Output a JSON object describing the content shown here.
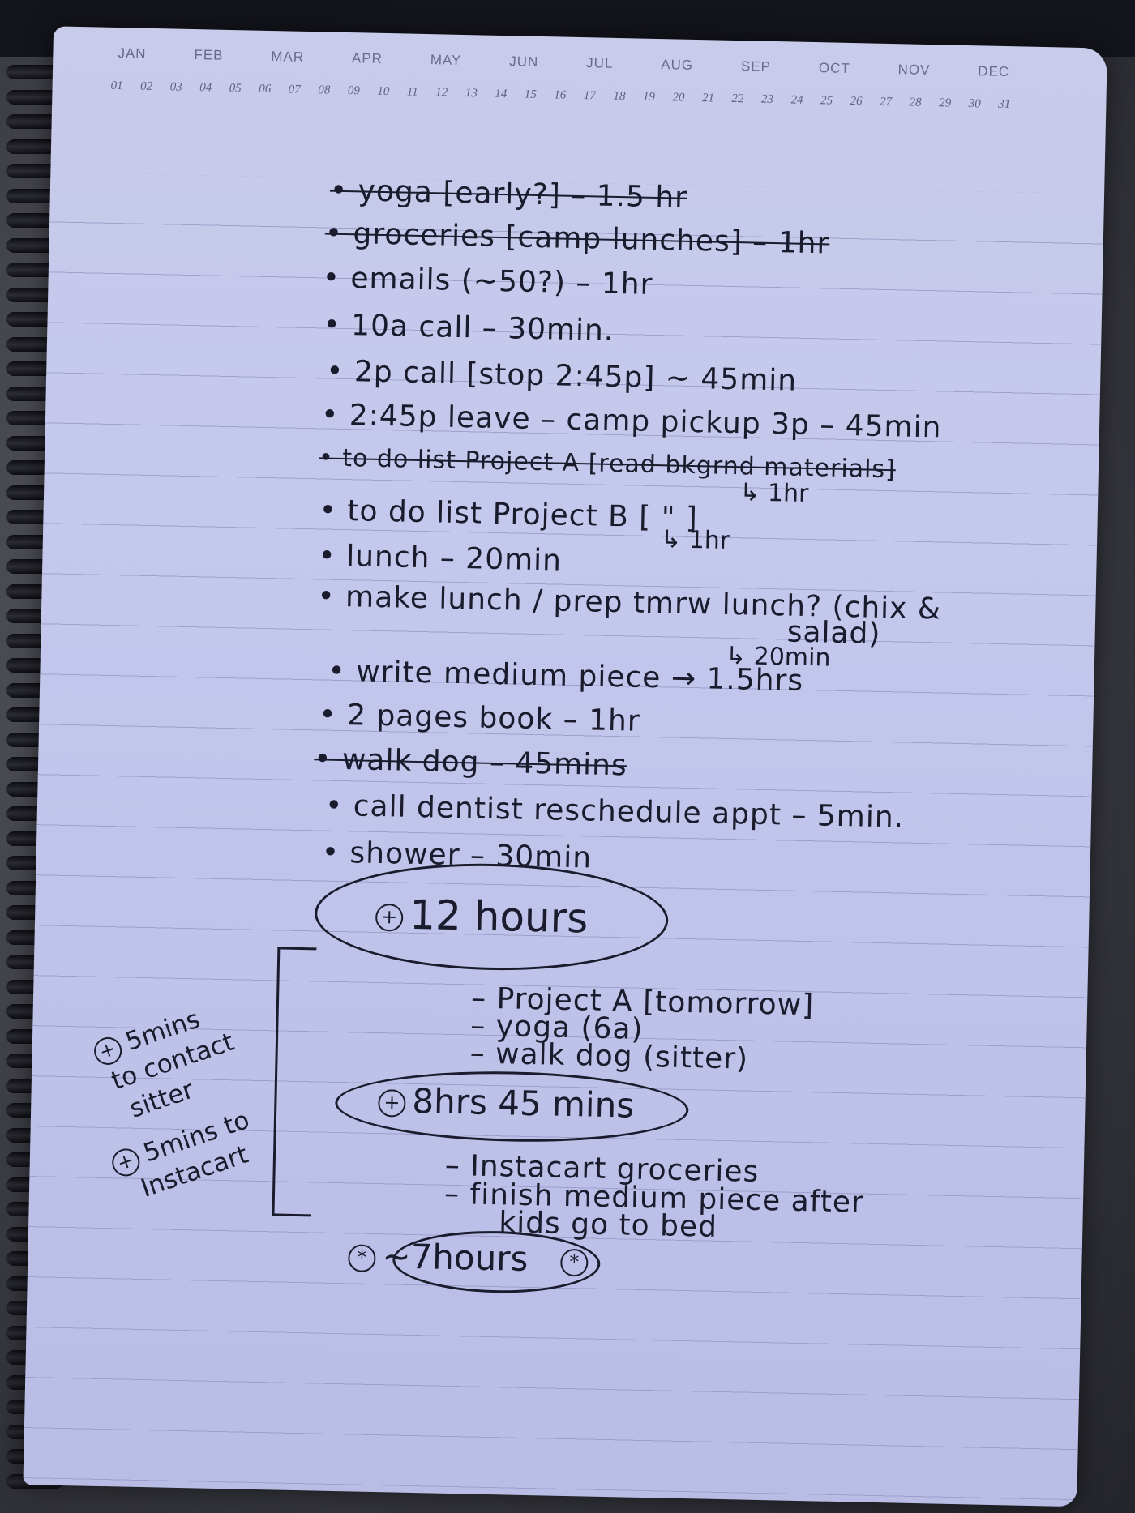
{
  "header": {
    "months": [
      "JAN",
      "FEB",
      "MAR",
      "APR",
      "MAY",
      "JUN",
      "JUL",
      "AUG",
      "SEP",
      "OCT",
      "NOV",
      "DEC"
    ],
    "days": [
      "01",
      "02",
      "03",
      "04",
      "05",
      "06",
      "07",
      "08",
      "09",
      "10",
      "11",
      "12",
      "13",
      "14",
      "15",
      "16",
      "17",
      "18",
      "19",
      "20",
      "21",
      "22",
      "23",
      "24",
      "25",
      "26",
      "27",
      "28",
      "29",
      "30",
      "31"
    ]
  },
  "tasks": [
    {
      "text": "• yoga [early?]  – 1.5 hr",
      "struck": true
    },
    {
      "text": "• groceries [camp lunches]  – 1hr",
      "struck": true
    },
    {
      "text": "• emails (~50?)   – 1hr",
      "struck": false
    },
    {
      "text": "• 10a call    – 30min.",
      "struck": false
    },
    {
      "text": "• 2p call   [stop 2:45p]   ~ 45min",
      "struck": false
    },
    {
      "text": "• 2:45p leave – camp pickup 3p – 45min",
      "struck": false
    },
    {
      "text": "• to do list Project A [read bkgrnd materials]",
      "struck": true
    },
    {
      "text": "↳ 1hr",
      "struck": false
    },
    {
      "text": "• to do list Project B [ \" ]",
      "struck": false
    },
    {
      "text": "↳ 1hr",
      "struck": false
    },
    {
      "text": "• lunch – 20min",
      "struck": false
    },
    {
      "text": "• make lunch / prep tmrw lunch? (chix &",
      "struck": false
    },
    {
      "text": "salad)",
      "struck": false
    },
    {
      "text": "↳ 20min",
      "struck": false
    },
    {
      "text": "• write medium piece → 1.5hrs",
      "struck": false
    },
    {
      "text": "• 2 pages book – 1hr",
      "struck": false
    },
    {
      "text": "• walk dog  – 45mins",
      "struck": true
    },
    {
      "text": "• call dentist reschedule appt – 5min.",
      "struck": false
    },
    {
      "text": "• shower – 30min",
      "struck": false
    }
  ],
  "total1": {
    "symbol": "+",
    "text": "12 hours"
  },
  "deferred": [
    "– Project A  [tomorrow]",
    "– yoga  (6a)",
    "– walk dog  (sitter)"
  ],
  "total2": {
    "symbol": "+",
    "text": "8hrs 45 mins"
  },
  "deferred2": [
    "– Instacart groceries",
    "– finish medium piece after",
    "kids go to bed"
  ],
  "total3": {
    "symbol": "*",
    "text": "~7hours",
    "symbol_end": "*"
  },
  "side_notes": [
    {
      "symbol": "+",
      "lines": [
        "5mins",
        "to contact",
        "sitter"
      ]
    },
    {
      "symbol": "+",
      "lines": [
        "5mins to",
        "Instacart"
      ]
    }
  ]
}
